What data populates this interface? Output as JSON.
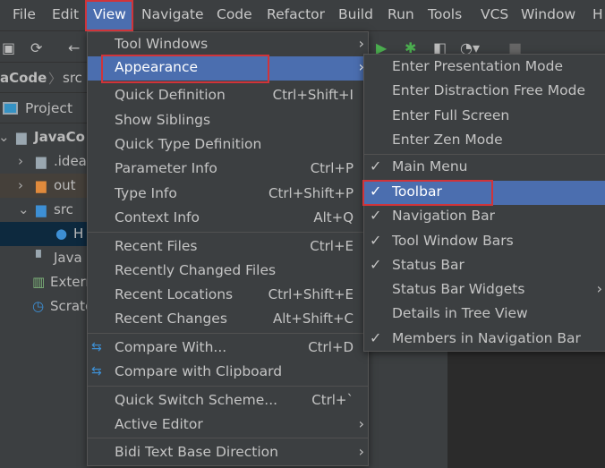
{
  "menubar": {
    "items": [
      "File",
      "Edit",
      "View",
      "Navigate",
      "Code",
      "Refactor",
      "Build",
      "Run",
      "Tools",
      "VCS",
      "Window",
      "H"
    ],
    "active": "View"
  },
  "breadcrumb": {
    "project": "aCode",
    "folder": "src"
  },
  "project_panel": {
    "title": "Project",
    "tree": [
      {
        "label": "JavaCo",
        "icon": "project-folder-icon",
        "expander": "v",
        "bold": true
      },
      {
        "label": ".idea",
        "icon": "folder-icon",
        "expander": ">"
      },
      {
        "label": "out",
        "icon": "orange-folder-icon",
        "expander": ">"
      },
      {
        "label": "src",
        "icon": "source-folder-icon",
        "expander": "v"
      },
      {
        "label": "H",
        "icon": "java-class-icon",
        "expander": "",
        "selected": true
      },
      {
        "label": "Java",
        "icon": "file-icon",
        "expander": ""
      },
      {
        "label": "Externa",
        "icon": "libraries-icon",
        "expander": ""
      },
      {
        "label": "Scratch",
        "icon": "scratches-icon",
        "expander": ""
      }
    ]
  },
  "view_menu": {
    "groups": [
      [
        {
          "label": "Tool Windows",
          "submenu": true
        },
        {
          "label": "Appearance",
          "submenu": true,
          "highlighted": true
        },
        {
          "label": "Quick Definition",
          "shortcut": "Ctrl+Shift+I"
        },
        {
          "label": "Show Siblings"
        },
        {
          "label": "Quick Type Definition"
        },
        {
          "label": "Parameter Info",
          "shortcut": "Ctrl+P"
        },
        {
          "label": "Type Info",
          "shortcut": "Ctrl+Shift+P"
        },
        {
          "label": "Context Info",
          "shortcut": "Alt+Q"
        }
      ],
      [
        {
          "label": "Recent Files",
          "shortcut": "Ctrl+E"
        },
        {
          "label": "Recently Changed Files"
        },
        {
          "label": "Recent Locations",
          "shortcut": "Ctrl+Shift+E"
        },
        {
          "label": "Recent Changes",
          "shortcut": "Alt+Shift+C"
        }
      ],
      [
        {
          "label": "Compare With...",
          "shortcut": "Ctrl+D",
          "icon": "compare-icon"
        },
        {
          "label": "Compare with Clipboard",
          "icon": "compare-clipboard-icon"
        }
      ],
      [
        {
          "label": "Quick Switch Scheme...",
          "shortcut": "Ctrl+`"
        },
        {
          "label": "Active Editor",
          "submenu": true
        }
      ],
      [
        {
          "label": "Bidi Text Base Direction",
          "submenu": true
        }
      ]
    ]
  },
  "appearance_menu": {
    "groups": [
      [
        {
          "label": "Enter Presentation Mode"
        },
        {
          "label": "Enter Distraction Free Mode"
        },
        {
          "label": "Enter Full Screen"
        },
        {
          "label": "Enter Zen Mode"
        }
      ],
      [
        {
          "label": "Main Menu",
          "checked": true
        },
        {
          "label": "Toolbar",
          "checked": true,
          "highlighted": true
        },
        {
          "label": "Navigation Bar",
          "checked": true
        },
        {
          "label": "Tool Window Bars",
          "checked": true
        },
        {
          "label": "Status Bar",
          "checked": true
        },
        {
          "label": "Status Bar Widgets",
          "submenu": true
        },
        {
          "label": "Details in Tree View"
        },
        {
          "label": "Members in Navigation Bar",
          "checked": true
        }
      ]
    ]
  },
  "colors": {
    "background": "#3c3f41",
    "highlight": "#4b6eaf",
    "annotation": "#d0343a",
    "text": "#bbbbbb"
  }
}
